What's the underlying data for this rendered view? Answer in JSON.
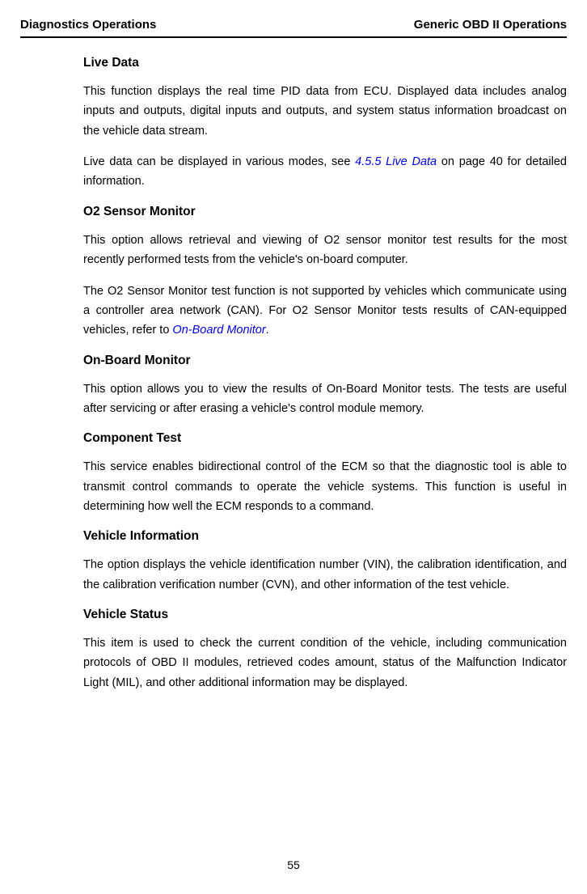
{
  "header": {
    "left": "Diagnostics Operations",
    "right": "Generic OBD II Operations"
  },
  "sections": {
    "live_data": {
      "heading": "Live Data",
      "p1": "This function displays the real time PID data from ECU. Displayed data includes analog inputs and outputs, digital inputs and outputs, and system status information broadcast on the vehicle data stream.",
      "p2_pre": "Live data can be displayed in various modes, see ",
      "p2_link": "4.5.5 Live Data",
      "p2_post": " on page 40 for detailed information."
    },
    "o2_sensor": {
      "heading": "O2 Sensor Monitor",
      "p1": "This option allows retrieval and viewing of O2 sensor monitor test results for the most recently performed tests from the vehicle's on-board computer.",
      "p2_pre": "The O2 Sensor Monitor test function is not supported by vehicles which communicate using a controller area network (CAN). For O2 Sensor Monitor tests results of CAN-equipped vehicles, refer to ",
      "p2_link": "On-Board Monitor",
      "p2_post": "."
    },
    "on_board": {
      "heading": "On-Board Monitor",
      "p1": "This option allows you to view the results of On-Board Monitor tests. The tests are useful after servicing or after erasing a vehicle's control module memory."
    },
    "component_test": {
      "heading": "Component Test",
      "p1": "This service enables bidirectional control of the ECM so that the diagnostic tool is able to transmit control commands to operate the vehicle systems. This function is useful in determining how well the ECM responds to a command."
    },
    "vehicle_info": {
      "heading": "Vehicle Information",
      "p1": "The option displays the vehicle identification number (VIN), the calibration identification, and the calibration verification number (CVN), and other information of the test vehicle."
    },
    "vehicle_status": {
      "heading": "Vehicle Status",
      "p1": "This item is used to check the current condition of the vehicle, including communication protocols of OBD II modules, retrieved codes amount, status of the Malfunction Indicator Light (MIL), and other additional information may be displayed."
    }
  },
  "page_number": "55"
}
